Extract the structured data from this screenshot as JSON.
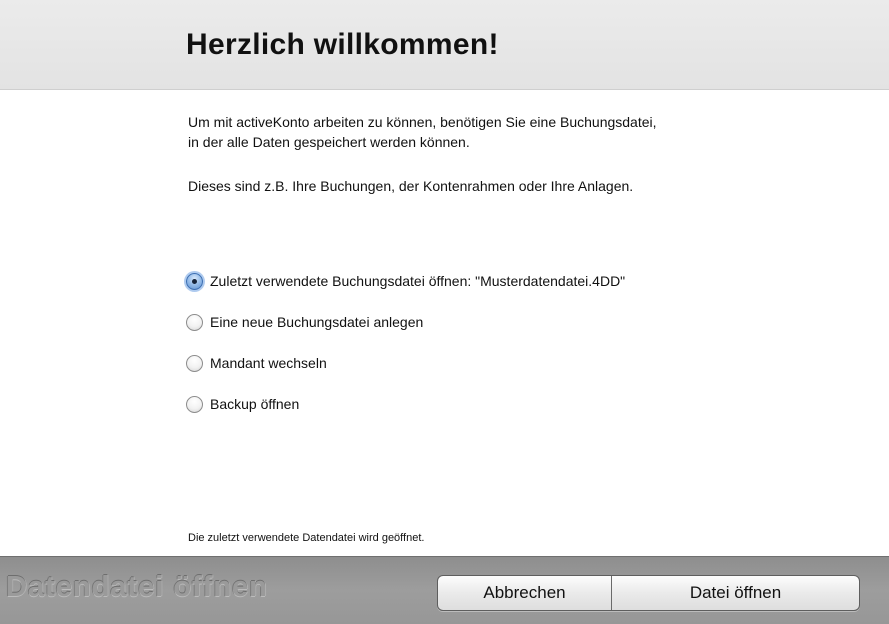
{
  "header": {
    "title": "Herzlich willkommen!"
  },
  "intro": {
    "line1": "Um mit activeKonto arbeiten zu können, benötigen Sie eine Buchungsdatei,",
    "line2": "in der alle Daten gespeichert werden können.",
    "line3": "Dieses sind z.B. Ihre Buchungen, der Kontenrahmen oder Ihre Anlagen."
  },
  "options": [
    {
      "label": "Zuletzt verwendete Buchungsdatei öffnen: \"Musterdatendatei.4DD\"",
      "selected": true
    },
    {
      "label": "Eine neue Buchungsdatei anlegen",
      "selected": false
    },
    {
      "label": "Mandant wechseln",
      "selected": false
    },
    {
      "label": "Backup öffnen",
      "selected": false
    }
  ],
  "hint": "Die zuletzt verwendete Datendatei wird geöffnet.",
  "footer": {
    "title": "Datendatei öffnen",
    "cancel_label": "Abbrechen",
    "open_label": "Datei öffnen"
  }
}
